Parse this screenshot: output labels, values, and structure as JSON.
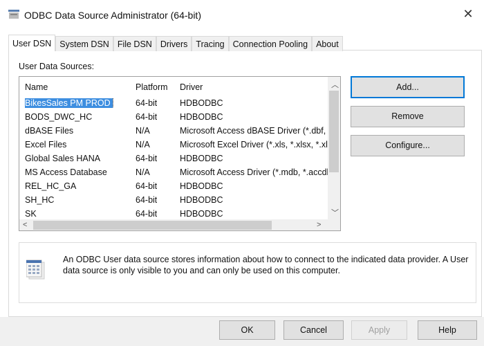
{
  "window": {
    "title": "ODBC Data Source Administrator (64-bit)",
    "close": "✕"
  },
  "tabs": [
    {
      "label": "User DSN",
      "active": true
    },
    {
      "label": "System DSN"
    },
    {
      "label": "File DSN"
    },
    {
      "label": "Drivers"
    },
    {
      "label": "Tracing"
    },
    {
      "label": "Connection Pooling"
    },
    {
      "label": "About"
    }
  ],
  "list": {
    "label": "User Data Sources:",
    "columns": [
      "Name",
      "Platform",
      "Driver"
    ],
    "rows": [
      [
        "BikesSales PM PROD",
        "64-bit",
        "HDBODBC"
      ],
      [
        "BODS_DWC_HC",
        "64-bit",
        "HDBODBC"
      ],
      [
        "dBASE Files",
        "N/A",
        "Microsoft Access dBASE Driver (*.dbf, *.ndx"
      ],
      [
        "Excel Files",
        "N/A",
        "Microsoft Excel Driver (*.xls, *.xlsx, *.xlsm"
      ],
      [
        "Global Sales HANA",
        "64-bit",
        "HDBODBC"
      ],
      [
        "MS Access Database",
        "N/A",
        "Microsoft Access Driver (*.mdb, *.accdb)"
      ],
      [
        "REL_HC_GA",
        "64-bit",
        "HDBODBC"
      ],
      [
        "SH_HC",
        "64-bit",
        "HDBODBC"
      ],
      [
        "SK",
        "64-bit",
        "HDBODBC"
      ]
    ],
    "selected": 0
  },
  "side_buttons": {
    "add": "Add...",
    "remove": "Remove",
    "configure": "Configure..."
  },
  "info": "An ODBC User data source stores information about how to connect to the indicated data provider.   A User data source is only visible to you and can only be used on this computer.",
  "footer": {
    "ok": "OK",
    "cancel": "Cancel",
    "apply": "Apply",
    "help": "Help"
  }
}
